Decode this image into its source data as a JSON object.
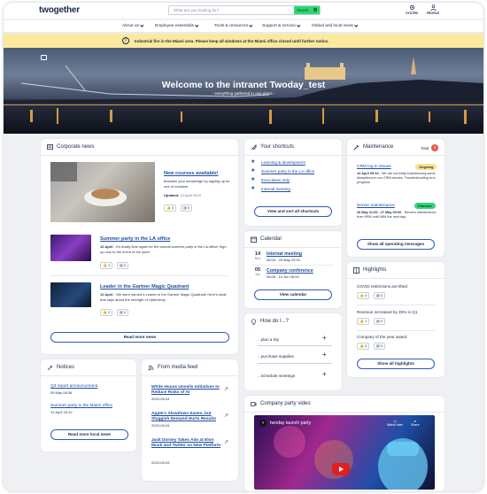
{
  "header": {
    "logo": "twogether",
    "search_placeholder": "What are you looking for?",
    "search_button": "Search",
    "system_label": "SYSTEM",
    "profile_label": "PROFILE"
  },
  "nav": [
    {
      "label": "About us"
    },
    {
      "label": "Employee essentials"
    },
    {
      "label": "Tools & resources"
    },
    {
      "label": "Support & service"
    },
    {
      "label": "Global and local news"
    }
  ],
  "alert": {
    "icon": "!",
    "text": "Industrial fire in the Miami area. Please keep all windows at the Miami office closed until further notice."
  },
  "hero": {
    "title": "Welcome to the intranet Twoday_test",
    "subtitle": "- everything gathered in one place -"
  },
  "corporate_news": {
    "title": "Corporate news",
    "featured": {
      "title": "New courses available!",
      "summary": "Broaden your knowledge by signing up for one of courses!",
      "updated_label": "Updated:",
      "updated_date": "12 April 2023",
      "likes": "0",
      "comments": "0"
    },
    "items": [
      {
        "title": "Summer party in the LA office",
        "date": "12 April",
        "summary": "- It's finally time again for the annual summer party in the LA office! Sign up now to the event of the year!",
        "likes": "1",
        "comments": "0"
      },
      {
        "title": "Leader in the Gartner Magic Quadrant",
        "date": "12 April",
        "summary": "- We were named a Leader in the Gartner Magic Quadrant! Here's what that says about the strength of Optimizely.",
        "likes": "0",
        "comments": "0"
      }
    ],
    "read_more": "Read more news"
  },
  "shortcuts": {
    "title": "Your shortcuts",
    "items": [
      "Learning & development",
      "Summer party in the LA office",
      "Executives only",
      "Internal meeting"
    ],
    "button": "View and sort all shortcuts"
  },
  "calendar": {
    "title": "Calendar",
    "events": [
      {
        "day": "14",
        "month": "Nov",
        "title": "Internal meeting",
        "time": "08:06 - 29 May 22:00"
      },
      {
        "day": "05",
        "month": "Jun",
        "title": "Company conference",
        "time": "08:06 - 14 Jun 08:00"
      }
    ],
    "button": "View calendar"
  },
  "howdoi": {
    "title": "How do I...?",
    "items": [
      "...plan a trip",
      "...purchase supplies",
      "...schedule meetings"
    ]
  },
  "maintenance": {
    "title": "Maintenance",
    "total_label": "Total",
    "total": "2",
    "items": [
      {
        "title": "CRM log in issues",
        "status": "Ongoing",
        "date": "12 April 09:34",
        "desc": "- We are currently experiencing some disruptions in our CRM service. Troubleshooting is in progress."
      },
      {
        "title": "Server maintenance",
        "status": "Planned",
        "date": "26 May 21:00 - 27 May 09:00",
        "desc": "- Servers maintenance from 9PM until 9AM the next day."
      }
    ],
    "button": "Show all operating messages"
  },
  "highlights": {
    "title": "Highlights",
    "items": [
      {
        "title": "COVID restrictions are lifted",
        "likes": "0",
        "comments": "0"
      },
      {
        "title": "Revenue increased by 25% in Q1",
        "likes": "1",
        "comments": "0"
      },
      {
        "title": "Company of the year award",
        "likes": "0",
        "comments": "0"
      }
    ],
    "button": "Show all highlights"
  },
  "notices": {
    "title": "Notices",
    "items": [
      {
        "title": "Q3 report announcement",
        "date": "05 May 06:36"
      },
      {
        "title": "Summer party in the Miami office",
        "date": "12 April 16:10"
      }
    ],
    "button": "Read more local news"
  },
  "media_feed": {
    "title": "From media feed",
    "items": [
      {
        "title": "White House Unveils Initiatives to Reduce Risks of AI",
        "date": "2023-05-04"
      },
      {
        "title": "Apple's Slowdown Eases, but Sluggish Demand Hurts Results",
        "date": "2023-05-04"
      },
      {
        "title": "Jack Dorsey Takes Aim at Elon Musk and Twitter on New Platform",
        "date": "2023-05-03"
      }
    ]
  },
  "video": {
    "title": "Company party video",
    "video_title": "twoday launch party",
    "watch_later": "Watch later",
    "share": "Share"
  },
  "colors": {
    "accent": "#1e4ea0",
    "search_green": "#2dd872",
    "alert_yellow": "#fbe99e",
    "ongoing": "#fbe28a",
    "planned": "#35d57a",
    "badge_red": "#e8564a"
  }
}
